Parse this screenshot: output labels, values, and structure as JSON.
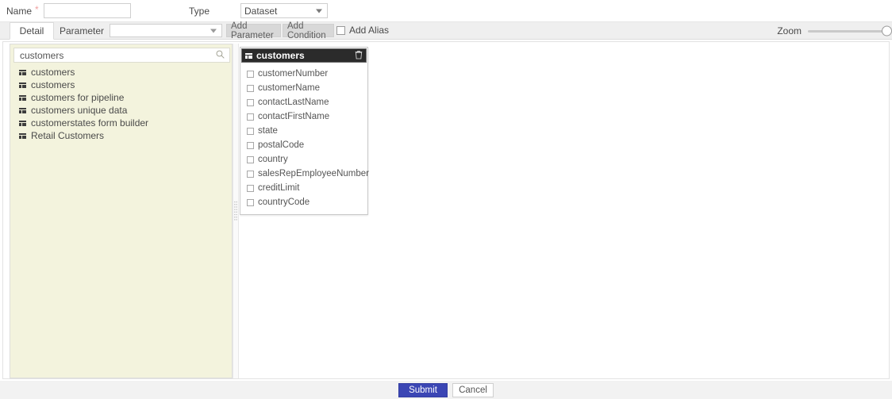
{
  "header": {
    "name_label": "Name",
    "required_marker": "*",
    "name_value": "",
    "name_placeholder": "",
    "type_label": "Type",
    "type_value": "Dataset"
  },
  "toolbar": {
    "tab_detail": "Detail",
    "tab_parameter": "Parameter",
    "parameter_value": "",
    "add_parameter_label": "Add Parameter",
    "add_condition_label": "Add Condition",
    "add_alias_label": "Add Alias",
    "add_alias_checked": false,
    "zoom_label": "Zoom",
    "zoom_value": 100
  },
  "left_panel": {
    "search_value": "customers",
    "search_placeholder": "",
    "items": [
      {
        "label": "customers"
      },
      {
        "label": "customers"
      },
      {
        "label": "customers for pipeline"
      },
      {
        "label": "customers unique data"
      },
      {
        "label": "customerstates form builder"
      },
      {
        "label": "Retail Customers"
      }
    ]
  },
  "canvas": {
    "table_card": {
      "title": "customers",
      "columns": [
        {
          "label": "customerNumber",
          "checked": false
        },
        {
          "label": "customerName",
          "checked": false
        },
        {
          "label": "contactLastName",
          "checked": false
        },
        {
          "label": "contactFirstName",
          "checked": false
        },
        {
          "label": "state",
          "checked": false
        },
        {
          "label": "postalCode",
          "checked": false
        },
        {
          "label": "country",
          "checked": false
        },
        {
          "label": "salesRepEmployeeNumber",
          "checked": false
        },
        {
          "label": "creditLimit",
          "checked": false
        },
        {
          "label": "countryCode",
          "checked": false
        }
      ]
    }
  },
  "footer": {
    "submit_label": "Submit",
    "cancel_label": "Cancel"
  },
  "colors": {
    "submit_blue": "#3b46b4",
    "panel_cream": "#f3f3dd",
    "card_header_dark": "#2b2b2b",
    "required_star": "#f0a0a0"
  }
}
